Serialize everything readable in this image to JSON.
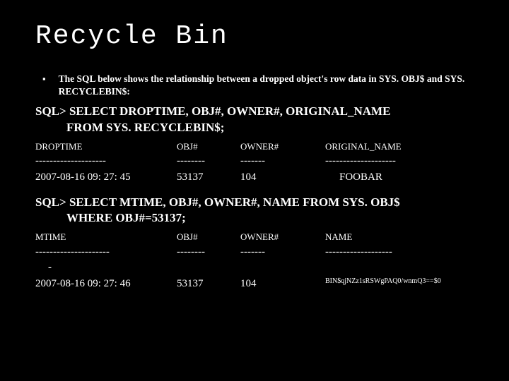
{
  "title": "Recycle Bin",
  "bullet": "The SQL below shows the relationship between a dropped object's row data in SYS. OBJ$ and SYS. RECYCLEBIN$:",
  "query1": {
    "line1": "SQL> SELECT DROPTIME, OBJ#, OWNER#, ORIGINAL_NAME",
    "line2": "FROM SYS. RECYCLEBIN$;",
    "headers": {
      "c1": "DROPTIME",
      "c2": "OBJ#",
      "c3": "OWNER#",
      "c4": "ORIGINAL_NAME"
    },
    "dashes": {
      "c1": "--------------------",
      "c2": "--------",
      "c3": "-------",
      "c4": "--------------------"
    },
    "row": {
      "c1": "2007-08-16 09: 27: 45",
      "c2": "53137",
      "c3": "104",
      "c4": "FOOBAR"
    }
  },
  "query2": {
    "line1": "SQL> SELECT MTIME, OBJ#, OWNER#, NAME FROM SYS. OBJ$",
    "line2": "WHERE OBJ#=53137;",
    "headers": {
      "c1": "MTIME",
      "c2": "OBJ#",
      "c3": "OWNER#",
      "c4": "NAME"
    },
    "dashes": {
      "c1": "---------------------",
      "c2": "--------",
      "c3": "-------",
      "c4": "-------------------"
    },
    "dashes_extra": "-",
    "row": {
      "c1": "2007-08-16 09: 27: 46",
      "c2": "53137",
      "c3": "104",
      "c4": "BIN$qjNZz1sRSWgPAQ0/wnmQ3==$0"
    }
  }
}
